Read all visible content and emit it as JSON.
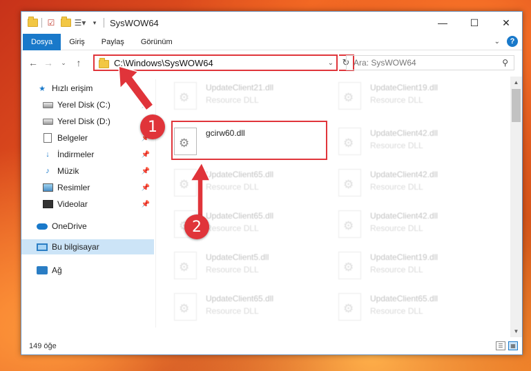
{
  "window": {
    "title": "SysWOW64",
    "controls": {
      "minimize": "—",
      "maximize": "☐",
      "close": "✕"
    }
  },
  "ribbon": {
    "tabs": [
      {
        "label": "Dosya",
        "active": true
      },
      {
        "label": "Giriş",
        "active": false
      },
      {
        "label": "Paylaş",
        "active": false
      },
      {
        "label": "Görünüm",
        "active": false
      }
    ],
    "help": "?"
  },
  "navbar": {
    "address": "C:\\Windows\\SysWOW64",
    "search_placeholder": "Ara: SysWOW64"
  },
  "sidebar": {
    "items": [
      {
        "label": "Hızlı erişim",
        "icon": "star-icon",
        "pinned": false
      },
      {
        "label": "Yerel Disk (C:)",
        "icon": "disk-icon",
        "pinned": true
      },
      {
        "label": "Yerel Disk (D:)",
        "icon": "disk-icon",
        "pinned": true
      },
      {
        "label": "Belgeler",
        "icon": "documents-icon",
        "pinned": true
      },
      {
        "label": "İndirmeler",
        "icon": "download-icon",
        "pinned": true
      },
      {
        "label": "Müzik",
        "icon": "music-icon",
        "pinned": true
      },
      {
        "label": "Resimler",
        "icon": "pictures-icon",
        "pinned": true
      },
      {
        "label": "Videolar",
        "icon": "videos-icon",
        "pinned": true
      },
      {
        "label": "OneDrive",
        "icon": "cloud-icon",
        "pinned": false
      },
      {
        "label": "Bu bilgisayar",
        "icon": "computer-icon",
        "pinned": false,
        "selected": true
      },
      {
        "label": "Ağ",
        "icon": "network-icon",
        "pinned": false
      }
    ]
  },
  "files": {
    "col1": [
      {
        "name": "UpdateClient21.dll",
        "type": "Resource DLL"
      },
      {
        "name": "gcirw60.dll",
        "type": "",
        "highlighted": true
      },
      {
        "name": "UpdateClient65.dll",
        "type": "Resource DLL"
      },
      {
        "name": "UpdateClient65.dll",
        "type": "Resource DLL"
      },
      {
        "name": "UpdateClient5.dll",
        "type": "Resource DLL"
      },
      {
        "name": "UpdateClient65.dll",
        "type": "Resource DLL"
      }
    ],
    "col2": [
      {
        "name": "UpdateClient19.dll",
        "type": "Resource DLL"
      },
      {
        "name": "UpdateClient42.dll",
        "type": "Resource DLL"
      },
      {
        "name": "UpdateClient42.dll",
        "type": "Resource DLL"
      },
      {
        "name": "UpdateClient42.dll",
        "type": "Resource DLL"
      },
      {
        "name": "UpdateClient19.dll",
        "type": "Resource DLL"
      },
      {
        "name": "UpdateClient65.dll",
        "type": "Resource DLL"
      }
    ]
  },
  "status": {
    "item_count": "149 öğe"
  },
  "annotations": {
    "step1": "1",
    "step2": "2",
    "color": "#e0343a"
  }
}
